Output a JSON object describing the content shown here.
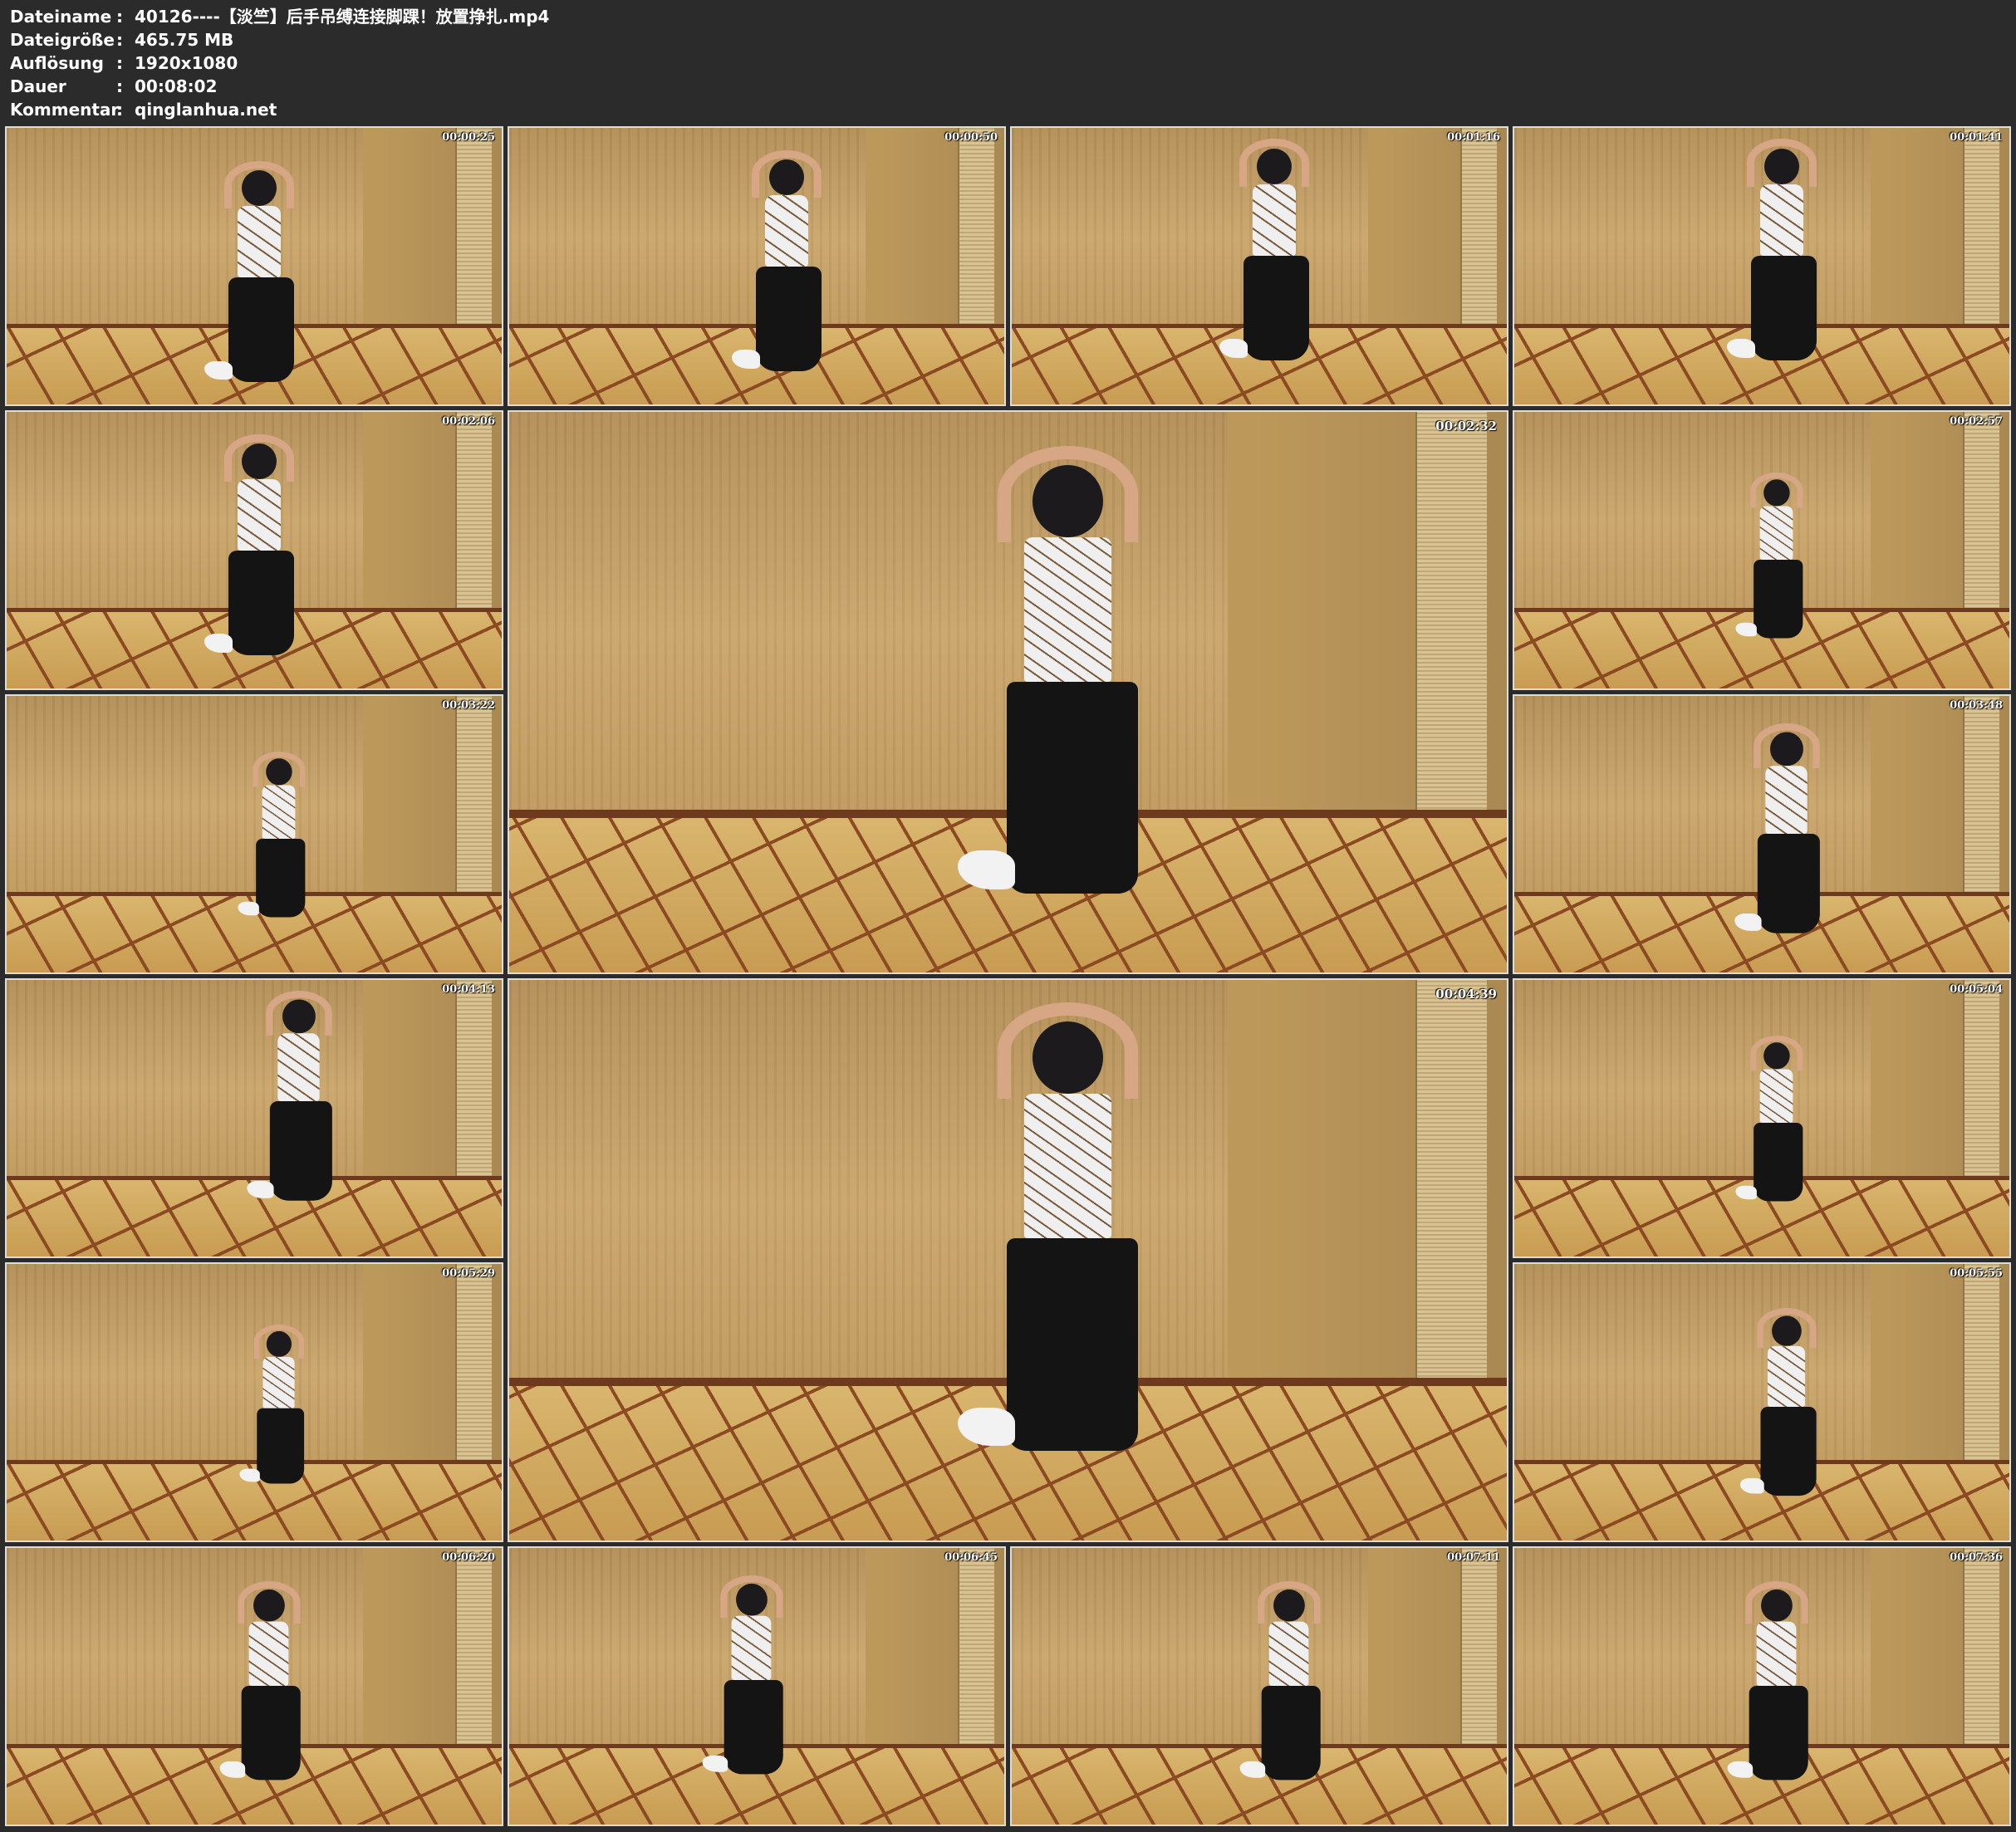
{
  "header": {
    "rows": [
      {
        "label": "Dateiname",
        "colon": ":",
        "value": "40126----【淡竺】后手吊缚连接脚踝！放置挣扎.mp4"
      },
      {
        "label": "Dateigröße",
        "colon": ":",
        "value": "465.75 MB"
      },
      {
        "label": "Auflösung",
        "colon": ":",
        "value": "1920x1080"
      },
      {
        "label": "Dauer",
        "colon": ":",
        "value": "00:08:02"
      },
      {
        "label": "Kommentar",
        "colon": ":",
        "value": "qinglanhua.net"
      }
    ]
  },
  "thumbnails": [
    {
      "timecode": "00:00:25"
    },
    {
      "timecode": "00:00:50"
    },
    {
      "timecode": "00:01:16"
    },
    {
      "timecode": "00:01:41"
    },
    {
      "timecode": "00:02:06"
    },
    {
      "timecode": "00:02:32"
    },
    {
      "timecode": "00:02:57"
    },
    {
      "timecode": "00:03:22"
    },
    {
      "timecode": "00:03:48"
    },
    {
      "timecode": "00:04:13"
    },
    {
      "timecode": "00:04:39"
    },
    {
      "timecode": "00:05:04"
    },
    {
      "timecode": "00:05:29"
    },
    {
      "timecode": "00:05:55"
    },
    {
      "timecode": "00:06:20"
    },
    {
      "timecode": "00:06:45"
    },
    {
      "timecode": "00:07:11"
    },
    {
      "timecode": "00:07:36"
    }
  ],
  "colors": {
    "background": "#2b2b2b",
    "header_text": "#ffffff",
    "wall": "#c4a068",
    "floor": "#d2ab62",
    "floor_border": "#8c4a22"
  }
}
